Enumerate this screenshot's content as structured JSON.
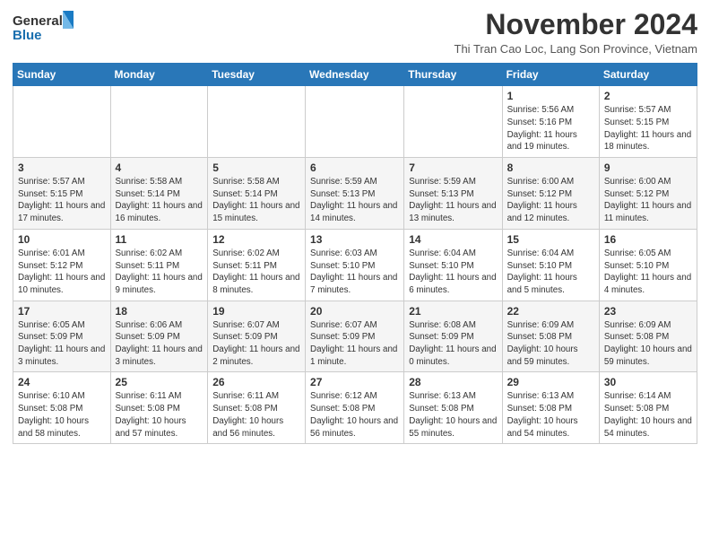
{
  "header": {
    "logo_general": "General",
    "logo_blue": "Blue",
    "month_title": "November 2024",
    "subtitle": "Thi Tran Cao Loc, Lang Son Province, Vietnam"
  },
  "weekdays": [
    "Sunday",
    "Monday",
    "Tuesday",
    "Wednesday",
    "Thursday",
    "Friday",
    "Saturday"
  ],
  "weeks": [
    [
      {
        "day": "",
        "info": ""
      },
      {
        "day": "",
        "info": ""
      },
      {
        "day": "",
        "info": ""
      },
      {
        "day": "",
        "info": ""
      },
      {
        "day": "",
        "info": ""
      },
      {
        "day": "1",
        "info": "Sunrise: 5:56 AM\nSunset: 5:16 PM\nDaylight: 11 hours and 19 minutes."
      },
      {
        "day": "2",
        "info": "Sunrise: 5:57 AM\nSunset: 5:15 PM\nDaylight: 11 hours and 18 minutes."
      }
    ],
    [
      {
        "day": "3",
        "info": "Sunrise: 5:57 AM\nSunset: 5:15 PM\nDaylight: 11 hours and 17 minutes."
      },
      {
        "day": "4",
        "info": "Sunrise: 5:58 AM\nSunset: 5:14 PM\nDaylight: 11 hours and 16 minutes."
      },
      {
        "day": "5",
        "info": "Sunrise: 5:58 AM\nSunset: 5:14 PM\nDaylight: 11 hours and 15 minutes."
      },
      {
        "day": "6",
        "info": "Sunrise: 5:59 AM\nSunset: 5:13 PM\nDaylight: 11 hours and 14 minutes."
      },
      {
        "day": "7",
        "info": "Sunrise: 5:59 AM\nSunset: 5:13 PM\nDaylight: 11 hours and 13 minutes."
      },
      {
        "day": "8",
        "info": "Sunrise: 6:00 AM\nSunset: 5:12 PM\nDaylight: 11 hours and 12 minutes."
      },
      {
        "day": "9",
        "info": "Sunrise: 6:00 AM\nSunset: 5:12 PM\nDaylight: 11 hours and 11 minutes."
      }
    ],
    [
      {
        "day": "10",
        "info": "Sunrise: 6:01 AM\nSunset: 5:12 PM\nDaylight: 11 hours and 10 minutes."
      },
      {
        "day": "11",
        "info": "Sunrise: 6:02 AM\nSunset: 5:11 PM\nDaylight: 11 hours and 9 minutes."
      },
      {
        "day": "12",
        "info": "Sunrise: 6:02 AM\nSunset: 5:11 PM\nDaylight: 11 hours and 8 minutes."
      },
      {
        "day": "13",
        "info": "Sunrise: 6:03 AM\nSunset: 5:10 PM\nDaylight: 11 hours and 7 minutes."
      },
      {
        "day": "14",
        "info": "Sunrise: 6:04 AM\nSunset: 5:10 PM\nDaylight: 11 hours and 6 minutes."
      },
      {
        "day": "15",
        "info": "Sunrise: 6:04 AM\nSunset: 5:10 PM\nDaylight: 11 hours and 5 minutes."
      },
      {
        "day": "16",
        "info": "Sunrise: 6:05 AM\nSunset: 5:10 PM\nDaylight: 11 hours and 4 minutes."
      }
    ],
    [
      {
        "day": "17",
        "info": "Sunrise: 6:05 AM\nSunset: 5:09 PM\nDaylight: 11 hours and 3 minutes."
      },
      {
        "day": "18",
        "info": "Sunrise: 6:06 AM\nSunset: 5:09 PM\nDaylight: 11 hours and 3 minutes."
      },
      {
        "day": "19",
        "info": "Sunrise: 6:07 AM\nSunset: 5:09 PM\nDaylight: 11 hours and 2 minutes."
      },
      {
        "day": "20",
        "info": "Sunrise: 6:07 AM\nSunset: 5:09 PM\nDaylight: 11 hours and 1 minute."
      },
      {
        "day": "21",
        "info": "Sunrise: 6:08 AM\nSunset: 5:09 PM\nDaylight: 11 hours and 0 minutes."
      },
      {
        "day": "22",
        "info": "Sunrise: 6:09 AM\nSunset: 5:08 PM\nDaylight: 10 hours and 59 minutes."
      },
      {
        "day": "23",
        "info": "Sunrise: 6:09 AM\nSunset: 5:08 PM\nDaylight: 10 hours and 59 minutes."
      }
    ],
    [
      {
        "day": "24",
        "info": "Sunrise: 6:10 AM\nSunset: 5:08 PM\nDaylight: 10 hours and 58 minutes."
      },
      {
        "day": "25",
        "info": "Sunrise: 6:11 AM\nSunset: 5:08 PM\nDaylight: 10 hours and 57 minutes."
      },
      {
        "day": "26",
        "info": "Sunrise: 6:11 AM\nSunset: 5:08 PM\nDaylight: 10 hours and 56 minutes."
      },
      {
        "day": "27",
        "info": "Sunrise: 6:12 AM\nSunset: 5:08 PM\nDaylight: 10 hours and 56 minutes."
      },
      {
        "day": "28",
        "info": "Sunrise: 6:13 AM\nSunset: 5:08 PM\nDaylight: 10 hours and 55 minutes."
      },
      {
        "day": "29",
        "info": "Sunrise: 6:13 AM\nSunset: 5:08 PM\nDaylight: 10 hours and 54 minutes."
      },
      {
        "day": "30",
        "info": "Sunrise: 6:14 AM\nSunset: 5:08 PM\nDaylight: 10 hours and 54 minutes."
      }
    ]
  ]
}
